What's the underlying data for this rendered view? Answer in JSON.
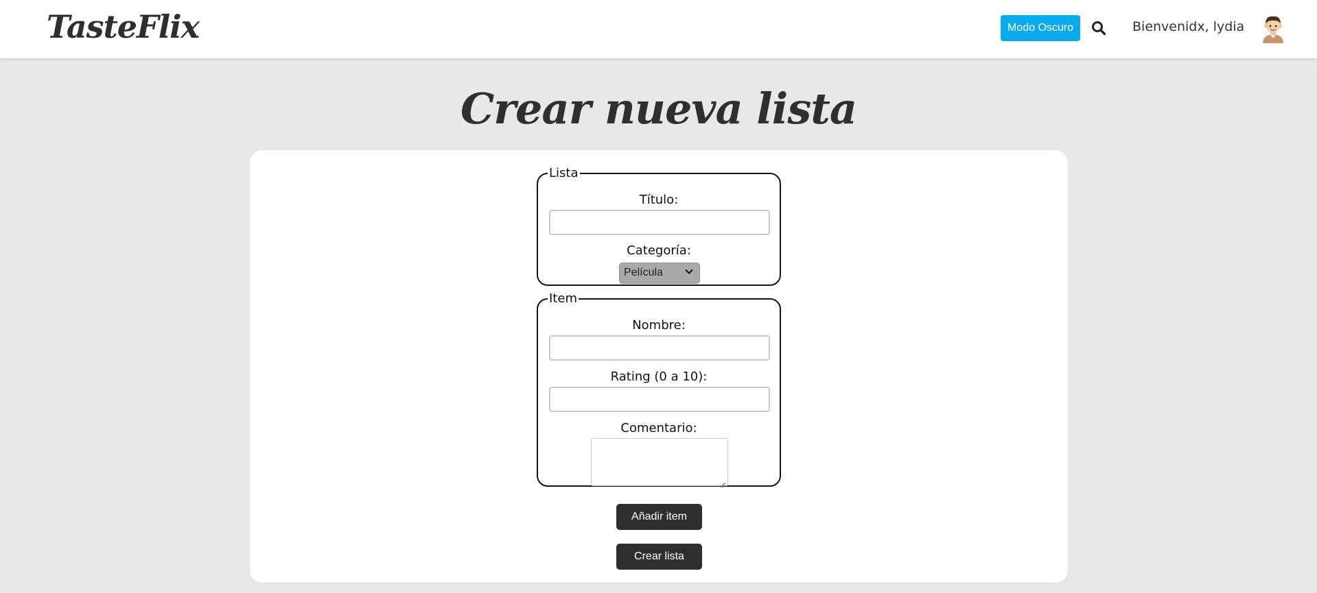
{
  "header": {
    "logo": "TasteFlix",
    "dark_mode_label": "Modo Oscuro",
    "search_icon": "search-icon",
    "welcome_text": "Bienvenidx, lydia",
    "avatar_icon": "avatar-icon"
  },
  "page": {
    "title": "Crear nueva lista"
  },
  "lista": {
    "legend": "Lista",
    "title_label": "Título:",
    "title_value": "",
    "category_label": "Categoría:",
    "category_selected": "Película"
  },
  "item": {
    "legend": "Item",
    "name_label": "Nombre:",
    "name_value": "",
    "rating_label": "Rating (0 a 10):",
    "rating_value": "",
    "comment_label": "Comentario:",
    "comment_value": ""
  },
  "actions": {
    "add_item_label": "Añadir item",
    "create_list_label": "Crear lista"
  },
  "colors": {
    "accent": "#0aa8ef",
    "dark_button": "#2e2e2e",
    "background": "#e8e8e8"
  }
}
